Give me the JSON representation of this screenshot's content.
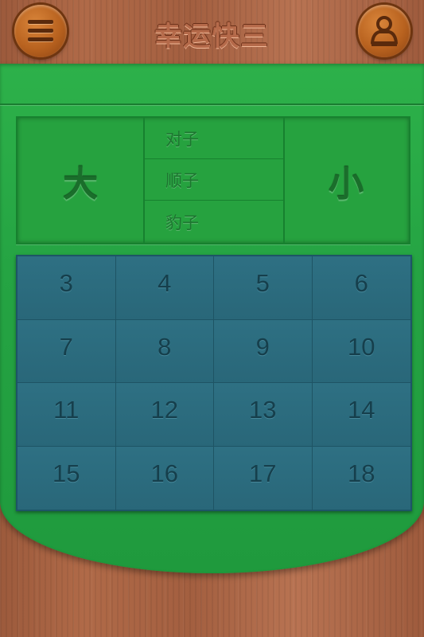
{
  "header": {
    "title": "幸运快三",
    "menu_icon": "menu-icon",
    "user_icon": "user-icon"
  },
  "bets": {
    "big": "大",
    "small": "小",
    "middle": [
      "对子",
      "顺子",
      "豹子"
    ]
  },
  "sums": [
    "3",
    "4",
    "5",
    "6",
    "7",
    "8",
    "9",
    "10",
    "11",
    "12",
    "13",
    "14",
    "15",
    "16",
    "17",
    "18"
  ],
  "colors": {
    "table_green": "#26a23f",
    "grid_teal": "#2a6a7c",
    "wood": "#a35f40"
  }
}
